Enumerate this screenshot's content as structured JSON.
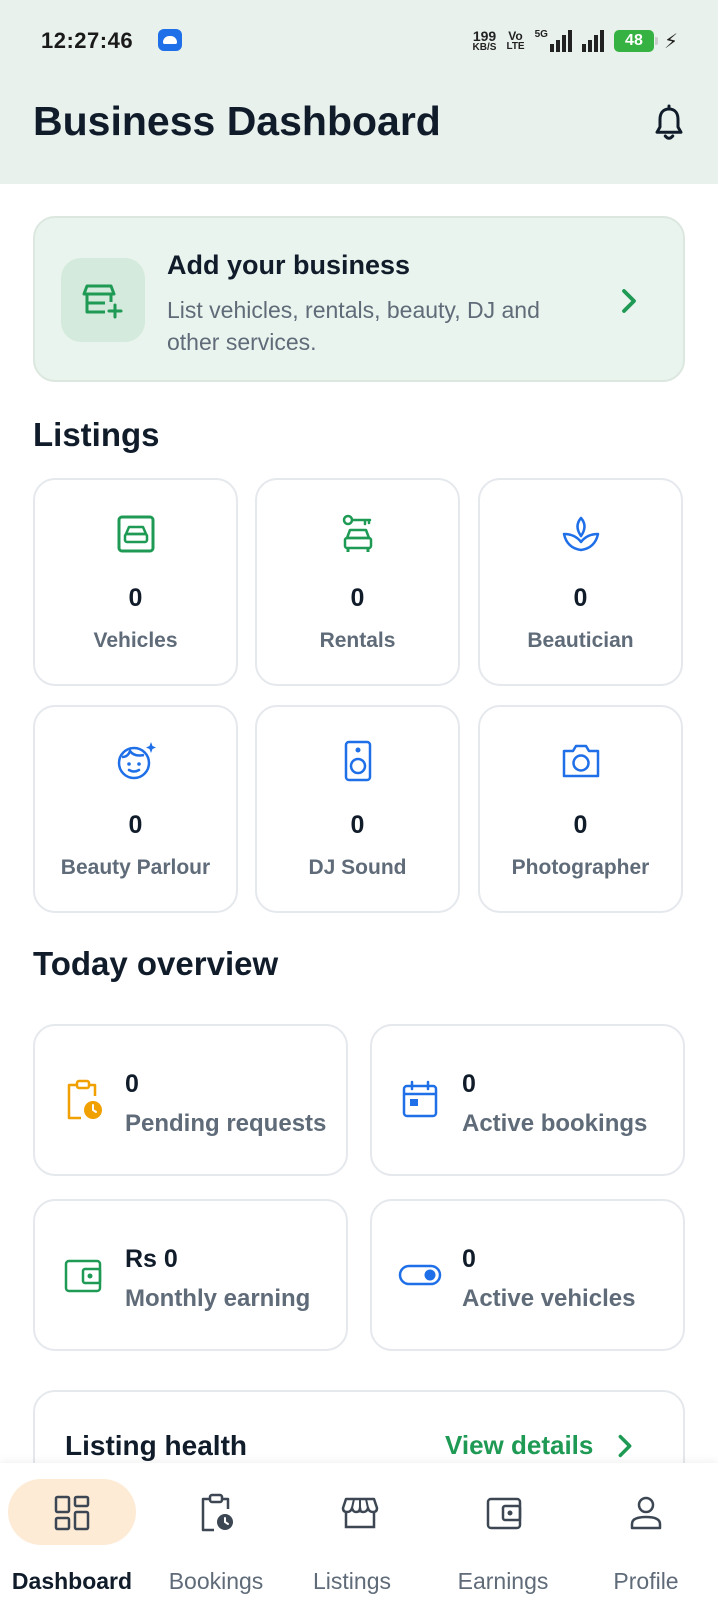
{
  "status_bar": {
    "time": "12:27:46",
    "net_speed_value": "199",
    "net_speed_unit": "KB/S",
    "volte_top": "Vo",
    "volte_bottom": "LTE",
    "network": "5G",
    "battery": "48"
  },
  "header": {
    "title": "Business Dashboard",
    "notification_icon": "bell-icon"
  },
  "add_business": {
    "title": "Add your business",
    "subtitle": "List vehicles, rentals, beauty, DJ and other services.",
    "icon": "store-add-icon"
  },
  "listings": {
    "title": "Listings",
    "items": [
      {
        "label": "Vehicles",
        "count": "0",
        "icon": "car-icon",
        "color": "#1e9a55"
      },
      {
        "label": "Rentals",
        "count": "0",
        "icon": "car-key-icon",
        "color": "#1e9a55"
      },
      {
        "label": "Beautician",
        "count": "0",
        "icon": "spa-icon",
        "color": "#1e6fe8"
      },
      {
        "label": "Beauty Parlour",
        "count": "0",
        "icon": "face-sparkle-icon",
        "color": "#1e6fe8"
      },
      {
        "label": "DJ Sound",
        "count": "0",
        "icon": "speaker-icon",
        "color": "#1e6fe8"
      },
      {
        "label": "Photographer",
        "count": "0",
        "icon": "camera-icon",
        "color": "#1e6fe8"
      }
    ]
  },
  "overview": {
    "title": "Today overview",
    "items": [
      {
        "value": "0",
        "label": "Pending requests",
        "icon": "clipboard-clock-icon",
        "color": "#f0a000"
      },
      {
        "value": "0",
        "label": "Active bookings",
        "icon": "calendar-icon",
        "color": "#1e6fe8"
      },
      {
        "value": "Rs 0",
        "label": "Monthly earning",
        "icon": "wallet-icon",
        "color": "#1e9a55"
      },
      {
        "value": "0",
        "label": "Active vehicles",
        "icon": "toggle-on-icon",
        "color": "#1e6fe8"
      }
    ]
  },
  "listing_health": {
    "title": "Listing health",
    "link": "View details"
  },
  "bottom_nav": {
    "items": [
      {
        "label": "Dashboard",
        "icon": "dashboard-icon",
        "active": true
      },
      {
        "label": "Bookings",
        "icon": "clipboard-clock-icon",
        "active": false
      },
      {
        "label": "Listings",
        "icon": "storefront-icon",
        "active": false
      },
      {
        "label": "Earnings",
        "icon": "wallet-icon",
        "active": false
      },
      {
        "label": "Profile",
        "icon": "person-icon",
        "active": false
      }
    ]
  },
  "colors": {
    "brand_green": "#1e9a55",
    "accent_blue": "#1e6fe8",
    "accent_orange": "#f0a000",
    "header_bg": "#e9f1ec",
    "active_nav_bg": "#fdebd6"
  }
}
